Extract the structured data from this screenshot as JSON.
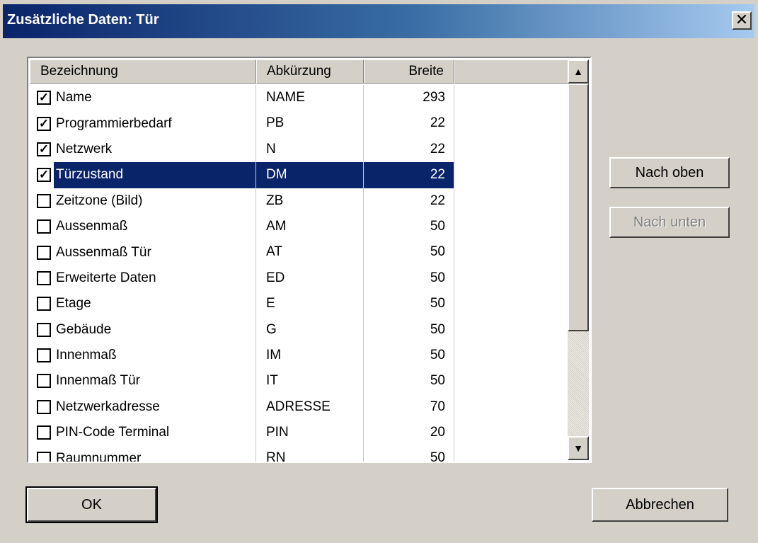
{
  "window": {
    "title": "Zusätzliche Daten: Tür",
    "close_symbol": "✕"
  },
  "list": {
    "columns": [
      "Bezeichnung",
      "Abkürzung",
      "Breite",
      ""
    ],
    "rows": [
      {
        "checked": true,
        "name": "Name",
        "abbr": "NAME",
        "width": "293",
        "selected": false
      },
      {
        "checked": true,
        "name": "Programmierbedarf",
        "abbr": "PB",
        "width": "22",
        "selected": false
      },
      {
        "checked": true,
        "name": "Netzwerk",
        "abbr": "N",
        "width": "22",
        "selected": false
      },
      {
        "checked": true,
        "name": "Türzustand",
        "abbr": "DM",
        "width": "22",
        "selected": true
      },
      {
        "checked": false,
        "name": "Zeitzone (Bild)",
        "abbr": "ZB",
        "width": "22",
        "selected": false
      },
      {
        "checked": false,
        "name": "Aussenmaß",
        "abbr": "AM",
        "width": "50",
        "selected": false
      },
      {
        "checked": false,
        "name": "Aussenmaß Tür",
        "abbr": "AT",
        "width": "50",
        "selected": false
      },
      {
        "checked": false,
        "name": "Erweiterte Daten",
        "abbr": "ED",
        "width": "50",
        "selected": false
      },
      {
        "checked": false,
        "name": "Etage",
        "abbr": "E",
        "width": "50",
        "selected": false
      },
      {
        "checked": false,
        "name": "Gebäude",
        "abbr": "G",
        "width": "50",
        "selected": false
      },
      {
        "checked": false,
        "name": "Innenmaß",
        "abbr": "IM",
        "width": "50",
        "selected": false
      },
      {
        "checked": false,
        "name": "Innenmaß Tür",
        "abbr": "IT",
        "width": "50",
        "selected": false
      },
      {
        "checked": false,
        "name": "Netzwerkadresse",
        "abbr": "ADRESSE",
        "width": "70",
        "selected": false
      },
      {
        "checked": false,
        "name": "PIN-Code Terminal",
        "abbr": "PIN",
        "width": "20",
        "selected": false
      },
      {
        "checked": false,
        "name": "Raumnummer",
        "abbr": "RN",
        "width": "50",
        "selected": false
      }
    ],
    "scroll_up_symbol": "▲",
    "scroll_down_symbol": "▼"
  },
  "buttons": {
    "move_up": "Nach oben",
    "move_down": "Nach unten",
    "ok": "OK",
    "cancel": "Abbrechen"
  },
  "colors": {
    "selection": "#0a246a",
    "dialog_bg": "#d4d0c8"
  }
}
